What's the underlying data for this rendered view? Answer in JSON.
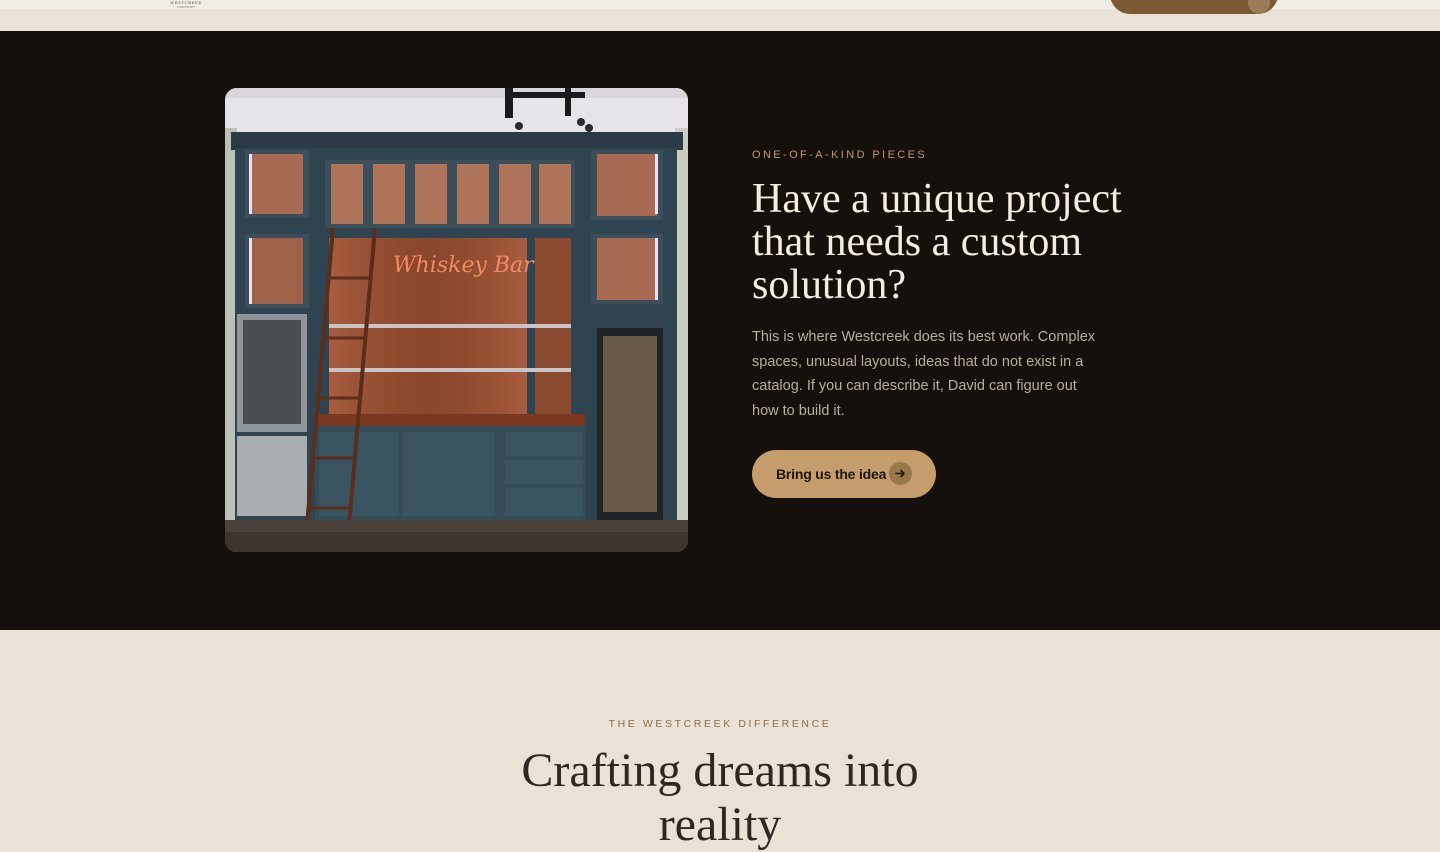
{
  "header": {
    "logo_text": "WESTCREEK",
    "logo_subtext": "CABINETRY",
    "cta_label": ""
  },
  "feature": {
    "eyebrow": "ONE-OF-A-KIND PIECES",
    "title": "Have a unique project that needs a custom solution?",
    "body": "This is where Westcreek does its best work. Complex spaces, unusual layouts, ideas that do not exist in a catalog. If you can describe it, David can figure out how to build it.",
    "cta_label": "Bring us the idea",
    "photo_sign_text": "Whiskey Bar"
  },
  "difference": {
    "eyebrow": "THE WESTCREEK DIFFERENCE",
    "title_line1": "Crafting dreams into",
    "title_line2": "reality"
  },
  "colors": {
    "dark_bg": "#15100b",
    "light_bg": "#eae2d5",
    "accent": "#c59d6c",
    "header_button": "#7a5a32"
  },
  "icons": {
    "cta": "arrow-right-icon"
  }
}
